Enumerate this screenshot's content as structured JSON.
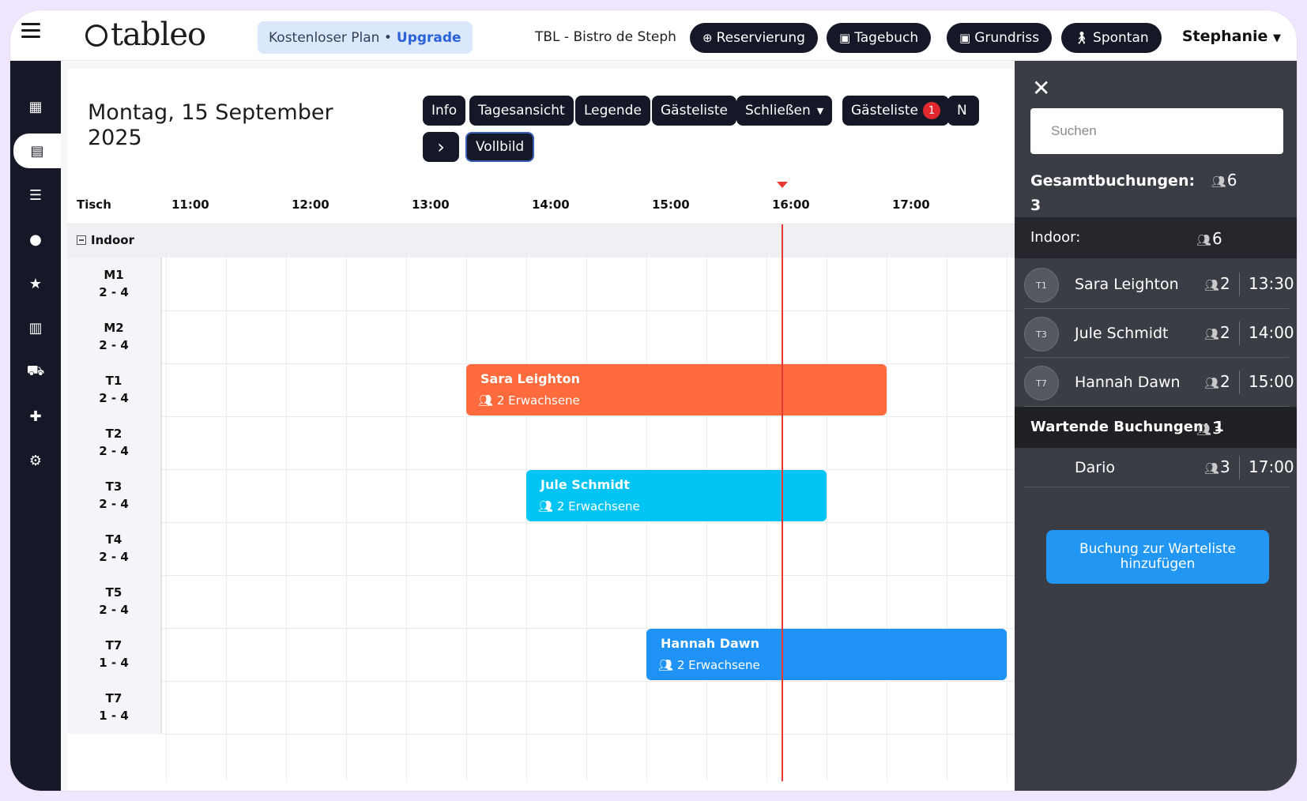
{
  "header": {
    "logo": "tableo",
    "plan_label": "Kostenloser Plan •",
    "upgrade_label": "Upgrade",
    "restaurant": "TBL - Bistro de Steph",
    "buttons": [
      "Reservierung",
      "Tagebuch",
      "Grundriss",
      "Spontan"
    ],
    "user": "Stephanie"
  },
  "sidebar": {
    "items": [
      "dashboard-icon",
      "book-icon",
      "list-icon",
      "user-icon",
      "star-icon",
      "chart-icon",
      "cart-icon",
      "puzzle-icon",
      "gear-icon"
    ],
    "active_index": 1
  },
  "main": {
    "date": "Montag, 15 September 2025",
    "controls": [
      "Info",
      "Tagesansicht",
      "Legende",
      "Gästeliste",
      "Schließen",
      "Gästeliste",
      "N"
    ],
    "guestlist_badge": "1",
    "next_label": "›",
    "fullscreen_label": "Vollbild",
    "column_header": "Tisch",
    "hours": [
      "11:00",
      "12:00",
      "13:00",
      "14:00",
      "15:00",
      "16:00",
      "17:00"
    ],
    "current_time": "16:08",
    "area": "Indoor",
    "tables": [
      {
        "name": "M1",
        "cap": "2 - 4"
      },
      {
        "name": "M2",
        "cap": "2 - 4"
      },
      {
        "name": "T1",
        "cap": "2 - 4"
      },
      {
        "name": "T2",
        "cap": "2 - 4"
      },
      {
        "name": "T3",
        "cap": "2 - 4"
      },
      {
        "name": "T4",
        "cap": "2 - 4"
      },
      {
        "name": "T5",
        "cap": "2 - 4"
      },
      {
        "name": "T7",
        "cap": "1 - 4"
      },
      {
        "name": "T7",
        "cap": "1 - 4"
      }
    ],
    "bookings": [
      {
        "name": "Sara Leighton",
        "guests": "2 Erwachsene",
        "table_index": 2,
        "start": "13:30",
        "end": "17:00",
        "color": "#ff6b3d"
      },
      {
        "name": "Jule Schmidt",
        "guests": "2 Erwachsene",
        "table_index": 4,
        "start": "14:00",
        "end": "16:30",
        "color": "#00c4f4"
      },
      {
        "name": "Hannah Dawn",
        "guests": "2 Erwachsene",
        "table_index": 7,
        "start": "15:00",
        "end": "18:00",
        "color": "#1f93f5"
      }
    ]
  },
  "panel": {
    "search_placeholder": "Suchen",
    "total_label": "Gesamtbuchungen:",
    "total_people": "6",
    "total_count": "3",
    "indoor_label": "Indoor:",
    "indoor_people": "6",
    "items": [
      {
        "table": "T1",
        "name": "Sara Leighton",
        "people": "2",
        "time": "13:30"
      },
      {
        "table": "T3",
        "name": "Jule Schmidt",
        "people": "2",
        "time": "14:00"
      },
      {
        "table": "T7",
        "name": "Hannah Dawn",
        "people": "2",
        "time": "15:00"
      }
    ],
    "waiting_label": "Wartende Buchungen: 1",
    "waiting_people": "3",
    "waiting_items": [
      {
        "name": "Dario",
        "people": "3",
        "time": "17:00"
      }
    ],
    "add_waitlist": "Buchung zur Warteliste hinzufügen"
  }
}
